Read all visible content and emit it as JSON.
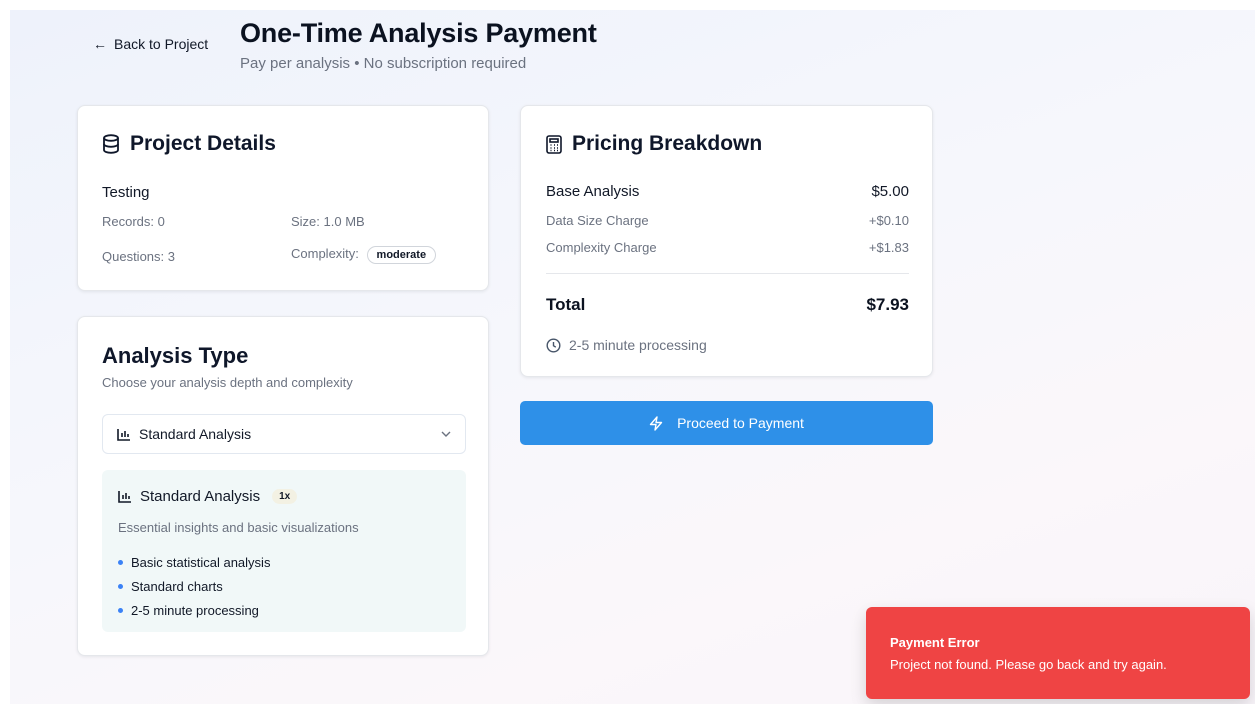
{
  "header": {
    "back_label": "Back to Project",
    "title": "One-Time Analysis Payment",
    "subtitle": "Pay per analysis • No subscription required"
  },
  "project_details": {
    "title": "Project Details",
    "name": "Testing",
    "records": "Records: 0",
    "size": "Size: 1.0 MB",
    "questions": "Questions: 3",
    "complexity_label": "Complexity:",
    "complexity_value": "moderate"
  },
  "analysis_type": {
    "title": "Analysis Type",
    "description": "Choose your analysis depth and complexity",
    "selected": "Standard Analysis",
    "detail": {
      "name": "Standard Analysis",
      "multiplier": "1x",
      "description": "Essential insights and basic visualizations",
      "features": [
        "Basic statistical analysis",
        "Standard charts",
        "2-5 minute processing"
      ]
    }
  },
  "pricing": {
    "title": "Pricing Breakdown",
    "base_label": "Base Analysis",
    "base_value": "$5.00",
    "size_label": "Data Size Charge",
    "size_value": "+$0.10",
    "complexity_label": "Complexity Charge",
    "complexity_value": "+$1.83",
    "total_label": "Total",
    "total_value": "$7.93",
    "processing": "2-5 minute processing"
  },
  "actions": {
    "proceed_label": "Proceed to Payment"
  },
  "toast": {
    "title": "Payment Error",
    "message": "Project not found. Please go back and try again."
  },
  "colors": {
    "primary_button": "#2e90e8",
    "error_toast": "#ef4444",
    "bullet": "#3b82f6"
  },
  "icons": [
    "arrow-left-icon",
    "database-icon",
    "calculator-icon",
    "bar-chart-icon",
    "chevron-down-icon",
    "clock-icon",
    "zap-icon"
  ]
}
